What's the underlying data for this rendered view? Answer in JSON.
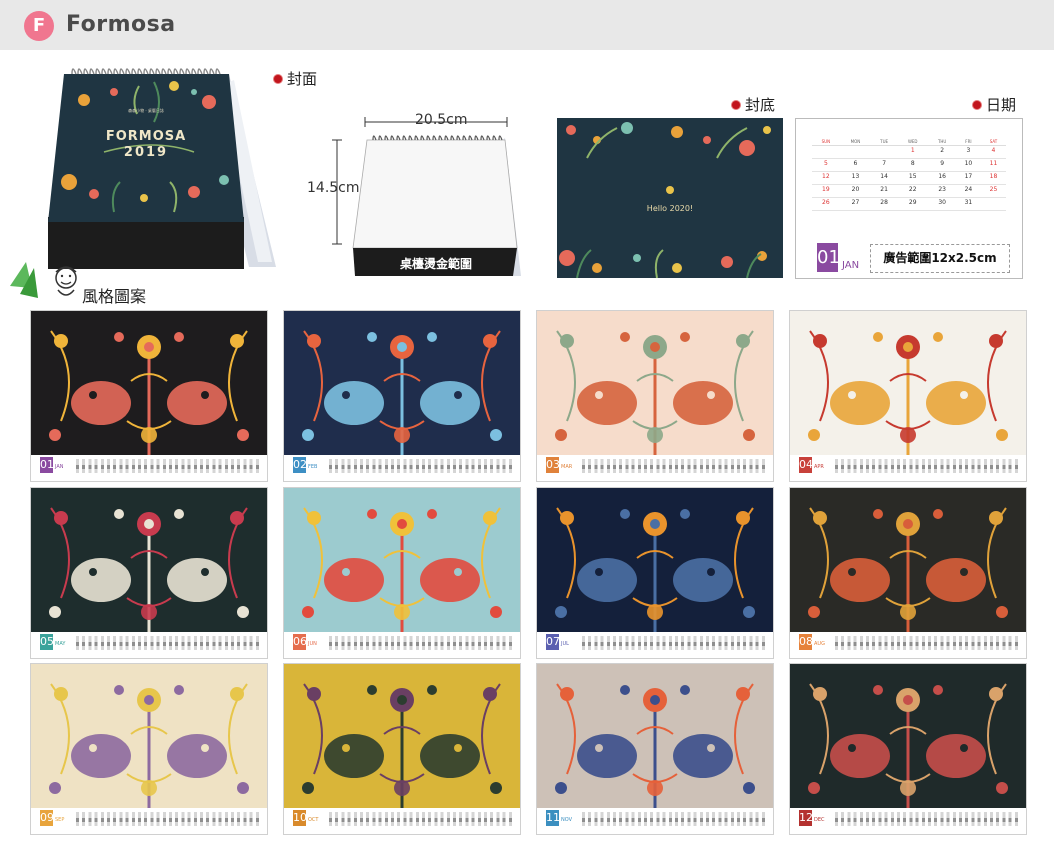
{
  "header": {
    "badge": "F",
    "brand": "Formosa"
  },
  "labels": {
    "cover": "封面",
    "back": "封底",
    "date": "日期",
    "style": "風格圖案"
  },
  "product": {
    "cover_title": "FORMOSA",
    "cover_year": "2019",
    "cover_small": "森森小物 · 桌曆日誌",
    "width": "20.5cm",
    "height": "14.5cm",
    "stamp_area": "桌檯燙金範圍"
  },
  "back_cover": {
    "text": "Hello 2020!"
  },
  "date_page": {
    "weekdays": [
      "SUN",
      "MON",
      "TUE",
      "WED",
      "THU",
      "FRI",
      "SAT"
    ],
    "weeks": [
      [
        "",
        "",
        "",
        "1",
        "2",
        "3",
        "4"
      ],
      [
        "5",
        "6",
        "7",
        "8",
        "9",
        "10",
        "11"
      ],
      [
        "12",
        "13",
        "14",
        "15",
        "16",
        "17",
        "18"
      ],
      [
        "19",
        "20",
        "21",
        "22",
        "23",
        "24",
        "25"
      ],
      [
        "26",
        "27",
        "28",
        "29",
        "30",
        "31",
        ""
      ]
    ],
    "month_num": "01",
    "month_name": "JAN",
    "ad_area": "廣告範圍12x2.5cm"
  },
  "months": [
    {
      "num": "01",
      "name": "JAN",
      "color": "#8a4aa0",
      "bg": "#1e1c1e",
      "accent": "#f0b43a",
      "accent2": "#e56a5a"
    },
    {
      "num": "02",
      "name": "FEB",
      "color": "#3d8fc4",
      "bg": "#1f2d4c",
      "accent": "#e7643f",
      "accent2": "#7cc0e0"
    },
    {
      "num": "03",
      "name": "MAR",
      "color": "#e0823b",
      "bg": "#f6dccb",
      "accent": "#8da88a",
      "accent2": "#d6643e"
    },
    {
      "num": "04",
      "name": "APR",
      "color": "#c8413b",
      "bg": "#f4f1ea",
      "accent": "#c63a2f",
      "accent2": "#e9a53a"
    },
    {
      "num": "05",
      "name": "MAY",
      "color": "#3aa39b",
      "bg": "#1e2d2d",
      "accent": "#c83b4e",
      "accent2": "#e8e3d4"
    },
    {
      "num": "06",
      "name": "JUN",
      "color": "#e56d4d",
      "bg": "#9ccbcf",
      "accent": "#f0c13a",
      "accent2": "#e24b3e"
    },
    {
      "num": "07",
      "name": "JUL",
      "color": "#5a5fb0",
      "bg": "#14203b",
      "accent": "#e9932c",
      "accent2": "#4a6fa4"
    },
    {
      "num": "08",
      "name": "AUG",
      "color": "#e6823a",
      "bg": "#2a2a26",
      "accent": "#e0a23a",
      "accent2": "#d85e3a"
    },
    {
      "num": "09",
      "name": "SEP",
      "color": "#e8a43c",
      "bg": "#efe2c4",
      "accent": "#e7c64b",
      "accent2": "#8d6aa0"
    },
    {
      "num": "10",
      "name": "OCT",
      "color": "#d98a2b",
      "bg": "#d9b539",
      "accent": "#6a3f63",
      "accent2": "#2c3d2f"
    },
    {
      "num": "11",
      "name": "NOV",
      "color": "#3b8fc0",
      "bg": "#cdc1b7",
      "accent": "#e5613a",
      "accent2": "#3c4f8c"
    },
    {
      "num": "12",
      "name": "DEC",
      "color": "#b4312f",
      "bg": "#1f2a2a",
      "accent": "#d9a26a",
      "accent2": "#c54e4a"
    }
  ]
}
